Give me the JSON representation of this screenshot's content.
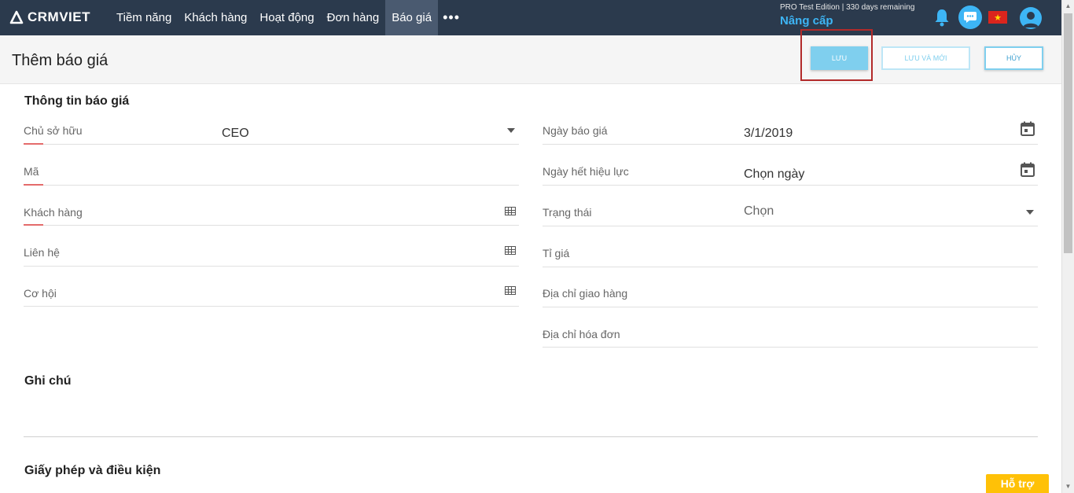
{
  "app": {
    "logo": "CRMVIET"
  },
  "nav": {
    "items": [
      "Tiềm năng",
      "Khách hàng",
      "Hoạt động",
      "Đơn hàng",
      "Báo giá"
    ],
    "more": "•••"
  },
  "account": {
    "edition": "PRO Test Edition | 330 days remaining",
    "upgrade": "Nâng cấp"
  },
  "page": {
    "title": "Thêm báo giá",
    "buttons": {
      "save": "LƯU",
      "save_new": "LƯU VÀ MỚI",
      "cancel": "HỦY"
    }
  },
  "form": {
    "section_info": "Thông tin báo giá",
    "left": [
      {
        "label": "Chủ sở hữu",
        "value": "CEO"
      },
      {
        "label": "Mã",
        "value": ""
      },
      {
        "label": "Khách hàng",
        "value": ""
      },
      {
        "label": "Liên hệ",
        "value": ""
      },
      {
        "label": "Cơ hội",
        "value": ""
      }
    ],
    "right": [
      {
        "label": "Ngày báo giá",
        "value": "3/1/2019"
      },
      {
        "label": "Ngày hết hiệu lực",
        "value": "Chọn ngày"
      },
      {
        "label": "Trạng thái",
        "value": "Chọn"
      },
      {
        "label": "Tỉ giá",
        "value": ""
      },
      {
        "label": "Địa chỉ giao hàng",
        "value": ""
      },
      {
        "label": "Địa chỉ hóa đơn",
        "value": ""
      }
    ],
    "section_notes": "Ghi chú",
    "section_terms": "Giấy phép và điều kiện"
  },
  "support": {
    "label": "Hỗ trợ"
  },
  "colors": {
    "topbar": "#2b3a4d",
    "accent": "#3db5f5",
    "support": "#ffc107",
    "required": "#e46b6b"
  }
}
